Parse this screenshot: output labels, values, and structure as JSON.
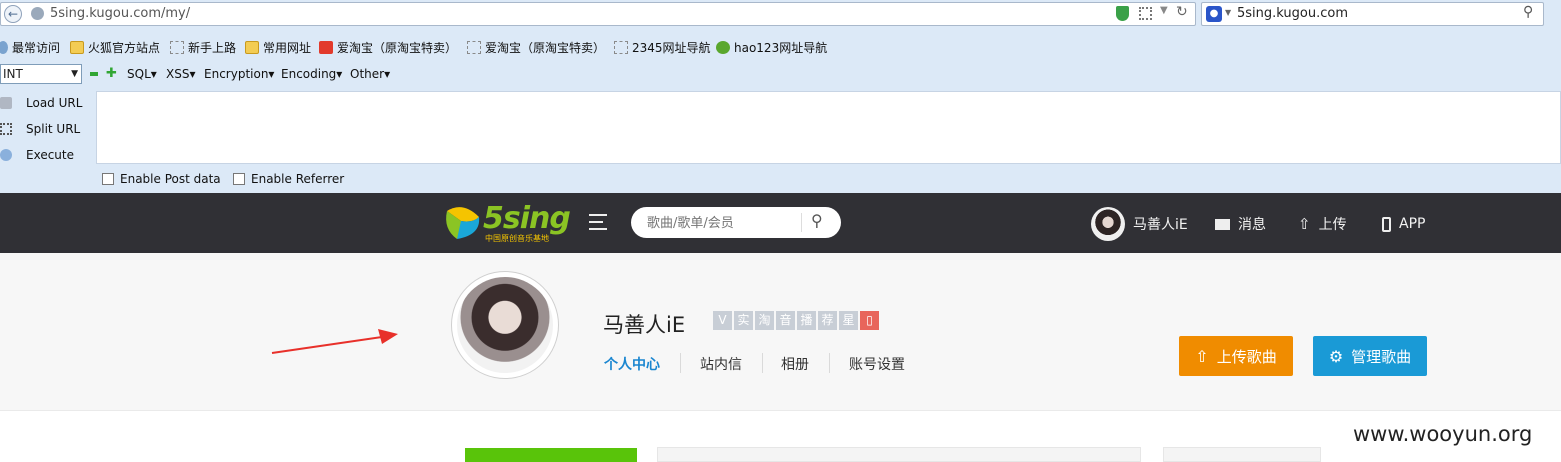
{
  "browser": {
    "url": "5sing.kugou.com/my/",
    "search_engine_text": "5sing.kugou.com",
    "bookmarks": [
      "最常访问",
      "火狐官方站点",
      "新手上路",
      "常用网址",
      "爱淘宝（原淘宝特卖）",
      "爱淘宝（原淘宝特卖）",
      "2345网址导航",
      "hao123网址导航"
    ],
    "hackbar": {
      "select_value": "INT",
      "menus": [
        "SQL▾",
        "XSS▾",
        "Encryption▾",
        "Encoding▾",
        "Other▾"
      ],
      "load_url": "Load URL",
      "split_url": "Split URL",
      "execute": "Execute",
      "post_data": "Enable Post data",
      "referrer": "Enable Referrer"
    }
  },
  "site": {
    "logo_text": "5sing",
    "logo_tagline": "中国原创音乐基地",
    "search_placeholder": "歌曲/歌单/会员",
    "user_name": "马善人iE",
    "message": "消息",
    "upload": "上传",
    "app": "APP"
  },
  "profile": {
    "name": "马善人iE",
    "badges": [
      "V",
      "实",
      "淘",
      "音",
      "播",
      "荐",
      "星"
    ],
    "tabs": [
      "个人中心",
      "站内信",
      "相册",
      "账号设置"
    ],
    "upload_button": "上传歌曲",
    "manage_button": "管理歌曲"
  },
  "watermark": "www.wooyun.org",
  "colors": {
    "nav_bg": "#303035",
    "upload_button": "#f08c00",
    "manage_button": "#1a9ad6",
    "active_tab": "#1a86d0",
    "logo_green": "#8bc424",
    "logo_yellow": "#f5c400",
    "annotation_arrow": "#e8302a"
  }
}
